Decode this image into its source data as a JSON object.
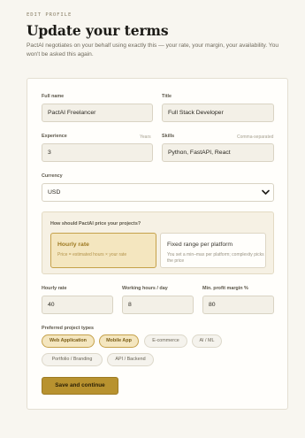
{
  "header": {
    "eyebrow": "EDIT PROFILE",
    "title": "Update your terms",
    "intro": "PactAI negotiates on your behalf using exactly this — your rate, your margin, your availability. You won't be asked this again."
  },
  "form": {
    "full_name": {
      "label": "Full name",
      "value": "PactAI Freelancer"
    },
    "title": {
      "label": "Title",
      "value": "Full Stack Developer"
    },
    "experience": {
      "label": "Experience",
      "hint": "Years",
      "value": "3"
    },
    "skills": {
      "label": "Skills",
      "hint": "Comma-separated",
      "value": "Python, FastAPI, React"
    },
    "currency": {
      "label": "Currency",
      "value": "USD"
    },
    "pricing": {
      "question": "How should PactAI price your projects?",
      "options": [
        {
          "title": "Hourly rate",
          "desc": "Price = estimated hours × your rate",
          "selected": true
        },
        {
          "title": "Fixed range per platform",
          "desc": "You set a min–max per platform; complexity picks the price",
          "selected": false
        }
      ]
    },
    "hourly_rate": {
      "label": "Hourly rate",
      "value": "40"
    },
    "working_hours": {
      "label": "Working hours / day",
      "value": "8"
    },
    "min_margin": {
      "label": "Min. profit margin %",
      "value": "80"
    },
    "project_types": {
      "label": "Preferred project types",
      "items": [
        {
          "label": "Web Application",
          "selected": true
        },
        {
          "label": "Mobile App",
          "selected": true
        },
        {
          "label": "E-commerce",
          "selected": false
        },
        {
          "label": "AI / ML",
          "selected": false
        },
        {
          "label": "Portfolio / Branding",
          "selected": false
        },
        {
          "label": "API / Backend",
          "selected": false
        }
      ]
    },
    "submit_label": "Save and continue"
  },
  "icons": {
    "currency_dropdown": "chevron-down-icon"
  },
  "colors": {
    "accent": "#b8922f",
    "accent_light": "#f4e6bf",
    "background": "#f8f6f0",
    "card": "#fffefb"
  }
}
